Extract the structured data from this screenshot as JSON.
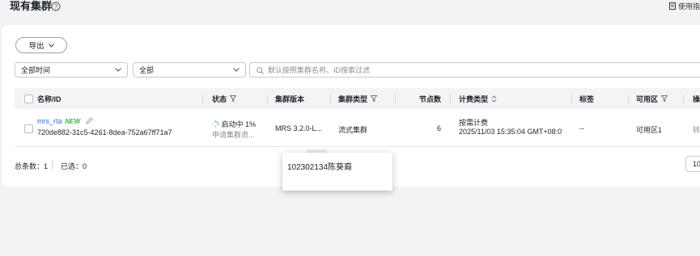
{
  "header": {
    "title": "现有集群",
    "doc_link": "使用指"
  },
  "toolbar": {
    "export_label": "导出"
  },
  "filters": {
    "time_value": "全部时间",
    "type_value": "全部",
    "search_placeholder": "默认按照集群名称、ID搜索过滤"
  },
  "table": {
    "columns": {
      "name": "名称/ID",
      "status": "状态",
      "version": "集群版本",
      "type": "集群类型",
      "nodes": "节点数",
      "billing": "计费类型",
      "tags": "标签",
      "az": "可用区",
      "ops": "操"
    },
    "rows": [
      {
        "name": "mrs_rta",
        "badge": "NEW",
        "id": "720de882-31c5-4261-8dea-752a67ff71a7",
        "status": "启动中 1%",
        "status_sub": "申请集群资...",
        "version": "MRS 3.2.0-L...",
        "type": "流式集群",
        "nodes": "6",
        "billing": "按需计费",
        "billing_time": "2025/11/03 15:35:04 GMT+08:00 t",
        "tags": "--",
        "az": "可用区1",
        "ops": "转"
      }
    ]
  },
  "footer": {
    "total": "总条数：1",
    "selected": "已选：0",
    "page_size": "10"
  },
  "tooltip": {
    "text": "102302134陈葵裔"
  },
  "colors": {
    "link": "#2f6fd1",
    "new_badge": "#3bb54a",
    "spinner": "#3bb54a"
  }
}
